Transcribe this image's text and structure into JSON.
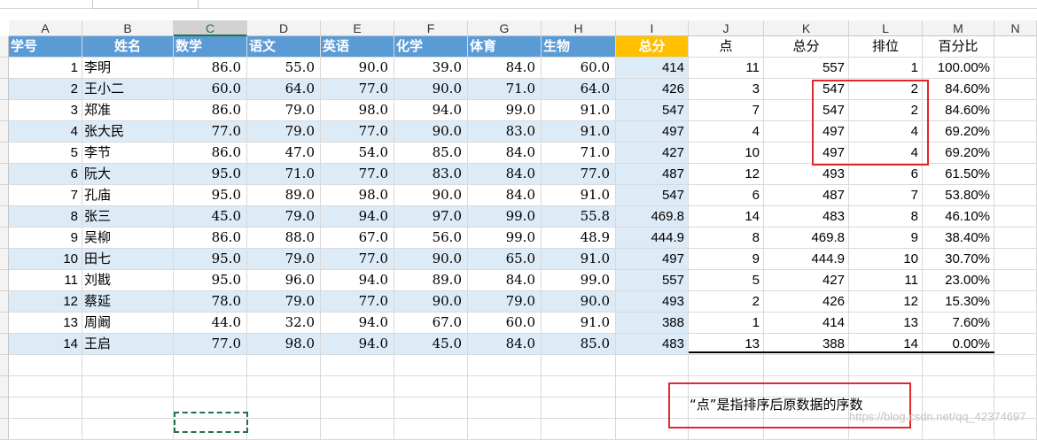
{
  "columns": [
    "A",
    "B",
    "C",
    "D",
    "E",
    "F",
    "G",
    "H",
    "I",
    "J",
    "K",
    "L",
    "M",
    "N"
  ],
  "selected_column": "C",
  "header": {
    "A": "学号",
    "B": "姓名",
    "C": "数学",
    "D": "语文",
    "E": "英语",
    "F": "化学",
    "G": "体育",
    "H": "生物",
    "I": "总分",
    "J": "点",
    "K": "总分",
    "L": "排位",
    "M": "百分比"
  },
  "students": [
    {
      "id": "1",
      "name": "李明",
      "math": "86.0",
      "chinese": "55.0",
      "english": "90.0",
      "chem": "39.0",
      "pe": "84.0",
      "bio": "60.0",
      "total": "414"
    },
    {
      "id": "2",
      "name": "王小二",
      "math": "60.0",
      "chinese": "64.0",
      "english": "77.0",
      "chem": "90.0",
      "pe": "71.0",
      "bio": "64.0",
      "total": "426"
    },
    {
      "id": "3",
      "name": "郑准",
      "math": "86.0",
      "chinese": "79.0",
      "english": "98.0",
      "chem": "94.0",
      "pe": "99.0",
      "bio": "91.0",
      "total": "547"
    },
    {
      "id": "4",
      "name": "张大民",
      "math": "77.0",
      "chinese": "79.0",
      "english": "77.0",
      "chem": "90.0",
      "pe": "83.0",
      "bio": "91.0",
      "total": "497"
    },
    {
      "id": "5",
      "name": "李节",
      "math": "86.0",
      "chinese": "47.0",
      "english": "54.0",
      "chem": "85.0",
      "pe": "84.0",
      "bio": "71.0",
      "total": "427"
    },
    {
      "id": "6",
      "name": "阮大",
      "math": "95.0",
      "chinese": "71.0",
      "english": "77.0",
      "chem": "83.0",
      "pe": "84.0",
      "bio": "77.0",
      "total": "487"
    },
    {
      "id": "7",
      "name": "孔庙",
      "math": "95.0",
      "chinese": "89.0",
      "english": "98.0",
      "chem": "90.0",
      "pe": "84.0",
      "bio": "91.0",
      "total": "547"
    },
    {
      "id": "8",
      "name": "张三",
      "math": "45.0",
      "chinese": "79.0",
      "english": "94.0",
      "chem": "97.0",
      "pe": "99.0",
      "bio": "55.8",
      "total": "469.8"
    },
    {
      "id": "9",
      "name": "吴柳",
      "math": "86.0",
      "chinese": "88.0",
      "english": "67.0",
      "chem": "56.0",
      "pe": "99.0",
      "bio": "48.9",
      "total": "444.9"
    },
    {
      "id": "10",
      "name": "田七",
      "math": "95.0",
      "chinese": "79.0",
      "english": "77.0",
      "chem": "90.0",
      "pe": "65.0",
      "bio": "91.0",
      "total": "497"
    },
    {
      "id": "11",
      "name": "刘戡",
      "math": "95.0",
      "chinese": "96.0",
      "english": "94.0",
      "chem": "89.0",
      "pe": "84.0",
      "bio": "99.0",
      "total": "557"
    },
    {
      "id": "12",
      "name": "蔡延",
      "math": "78.0",
      "chinese": "79.0",
      "english": "77.0",
      "chem": "90.0",
      "pe": "79.0",
      "bio": "90.0",
      "total": "493"
    },
    {
      "id": "13",
      "name": "周阚",
      "math": "44.0",
      "chinese": "32.0",
      "english": "94.0",
      "chem": "67.0",
      "pe": "60.0",
      "bio": "91.0",
      "total": "388"
    },
    {
      "id": "14",
      "name": "王启",
      "math": "77.0",
      "chinese": "98.0",
      "english": "94.0",
      "chem": "45.0",
      "pe": "84.0",
      "bio": "85.0",
      "total": "483"
    }
  ],
  "rank_table": [
    {
      "point": "11",
      "total": "557",
      "rank": "1",
      "pct": "100.00%"
    },
    {
      "point": "3",
      "total": "547",
      "rank": "2",
      "pct": "84.60%"
    },
    {
      "point": "7",
      "total": "547",
      "rank": "2",
      "pct": "84.60%"
    },
    {
      "point": "4",
      "total": "497",
      "rank": "4",
      "pct": "69.20%"
    },
    {
      "point": "10",
      "total": "497",
      "rank": "4",
      "pct": "69.20%"
    },
    {
      "point": "12",
      "total": "493",
      "rank": "6",
      "pct": "61.50%"
    },
    {
      "point": "6",
      "total": "487",
      "rank": "7",
      "pct": "53.80%"
    },
    {
      "point": "14",
      "total": "483",
      "rank": "8",
      "pct": "46.10%"
    },
    {
      "point": "8",
      "total": "469.8",
      "rank": "9",
      "pct": "38.40%"
    },
    {
      "point": "9",
      "total": "444.9",
      "rank": "10",
      "pct": "30.70%"
    },
    {
      "point": "5",
      "total": "427",
      "rank": "11",
      "pct": "23.00%"
    },
    {
      "point": "2",
      "total": "426",
      "rank": "12",
      "pct": "15.30%"
    },
    {
      "point": "1",
      "total": "414",
      "rank": "13",
      "pct": "7.60%"
    },
    {
      "point": "13",
      "total": "388",
      "rank": "14",
      "pct": "0.00%"
    }
  ],
  "note": "“点”是指排序后原数据的序数",
  "watermark": "https://blog.csdn.net/qq_42374697",
  "colors": {
    "header_blue": "#5b9bd5",
    "header_orange": "#ffc000",
    "band": "#ddebf7",
    "highlight_red": "#e0282d",
    "selection_green": "#217346"
  }
}
